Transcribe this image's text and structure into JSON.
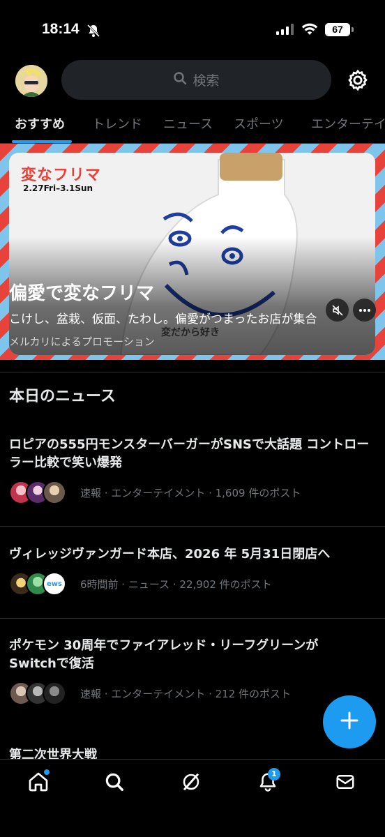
{
  "status": {
    "time": "18:14",
    "battery": "67"
  },
  "header": {
    "search_placeholder": "検索"
  },
  "tabs": [
    {
      "label": "おすすめ"
    },
    {
      "label": "トレンド"
    },
    {
      "label": "ニュース"
    },
    {
      "label": "スポーツ"
    },
    {
      "label": "エンターテイ"
    }
  ],
  "promo": {
    "logo": "変なフリマ",
    "dates": "2.27Fri–3.1Sun",
    "title": "偏愛で変なフリマ",
    "subtitle": "こけし、盆栽、仮面、たわし。偏愛がつまったお店が集合",
    "sponsor": "メルカリによるプロモーション",
    "bottle_text": "変だから好き"
  },
  "section": {
    "title": "本日のニュース"
  },
  "news": [
    {
      "title": "ロピアの555円モンスターバーガーがSNSで大話題 コントローラー比較で笑い爆発",
      "meta": "速報 · エンターテイメント · 1,609 件のポスト"
    },
    {
      "title": "ヴィレッジヴァンガード本店、2026 年 5月31日閉店へ",
      "meta": "6時間前 · ニュース · 22,902 件のポスト"
    },
    {
      "title": "ポケモン 30周年でファイアレッド・リーフグリーンがSwitchで復活",
      "meta": "速報 · エンターテイメント · 212 件のポスト"
    }
  ],
  "peek_title": "第二次世界大戦",
  "nav": {
    "notifications_badge": "1"
  },
  "colors": {
    "accent": "#1d9bf0",
    "background": "#000000"
  }
}
